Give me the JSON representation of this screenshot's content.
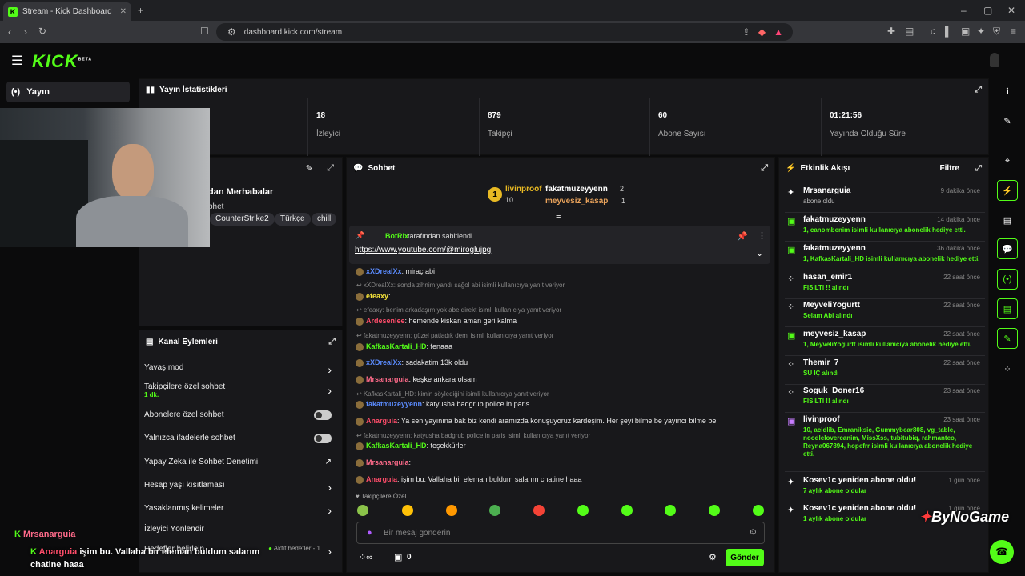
{
  "browser": {
    "tab_title": "Stream - Kick Dashboard",
    "url": "dashboard.kick.com/stream"
  },
  "brand": {
    "logo": "KICK",
    "beta": "BETA",
    "accent": "#53fc18"
  },
  "sidebar": {
    "yayin_label": "Yayın"
  },
  "stats": {
    "title": "Yayın İstatistikleri",
    "items": [
      {
        "value": "18",
        "label": "İzleyici"
      },
      {
        "value": "879",
        "label": "Takipçi"
      },
      {
        "value": "60",
        "label": "Abone Sayısı"
      },
      {
        "value": "01:21:56",
        "label": "Yayında Olduğu Süre"
      }
    ]
  },
  "stream_info": {
    "title_partial": "dan Merhabalar",
    "sub_partial": "bhet",
    "tags": [
      "CounterStrike2",
      "Türkçe",
      "chill"
    ]
  },
  "channel_actions": {
    "title": "Kanal Eylemleri",
    "items": [
      {
        "label": "Yavaş mod",
        "control": "chevron"
      },
      {
        "label": "Takipçilere özel sohbet",
        "sub": "1 dk.",
        "control": "chevron"
      },
      {
        "label": "Abonelere özel sohbet",
        "control": "toggle"
      },
      {
        "label": "Yalnızca ifadelerle sohbet",
        "control": "toggle"
      },
      {
        "label": "Yapay Zeka ile Sohbet Denetimi",
        "control": "external"
      },
      {
        "label": "Hesap yaşı kısıtlaması",
        "control": "chevron"
      },
      {
        "label": "Yasaklanmış kelimeler",
        "control": "chevron"
      },
      {
        "label": "İzleyici Yönlendir",
        "control": "none"
      },
      {
        "label": "Hedefler belirlein",
        "extra": "Aktif hedefler - 1",
        "control": "chevron"
      }
    ]
  },
  "chat": {
    "title": "Sohbet",
    "leaders": {
      "first_name": "livinproof",
      "first_count": "10",
      "second_name": "fakatmuzeyyenn",
      "second_count": "2",
      "third_name": "meyvesiz_kasap",
      "third_count": "1"
    },
    "pinned": {
      "by": "BotRix",
      "by_suffix": "tarafından sabitlendi",
      "link": "https://www.youtube.com/@miroglujpg"
    },
    "messages": [
      {
        "reply": "",
        "user": "xXDrealXx",
        "color": "#5b8cff",
        "text": "miraç abi"
      },
      {
        "reply": "xXDrealXx: sonda zihnim yandı sağol abi isimli kullanıcıya yanıt veriyor",
        "user": "efeaxy",
        "color": "#f5e33b",
        "text": ""
      },
      {
        "reply": "efeaxy: benim arkadaşım yok abe direkt isimli kullanıcıya yanıt veriyor",
        "user": "Ardesenlee",
        "color": "#ff4d6a",
        "text": "hemende kiskan aman geri kalma"
      },
      {
        "reply": "fakatmuzeyyenn: güzel patladık demi isimli kullanıcıya yanıt veriyor",
        "user": "KafkasKartali_HD",
        "color": "#53fc18",
        "text": "fenaaa"
      },
      {
        "reply": "",
        "user": "xXDrealXx",
        "color": "#5b8cff",
        "text": "sadakatim 13k oldu"
      },
      {
        "reply": "",
        "user": "Mrsanarguia",
        "color": "#ff6b8a",
        "text": "keşke ankara olsam"
      },
      {
        "reply": "KafkasKartali_HD: kimin söylediğini isimli kullanıcıya yanıt veriyor",
        "user": "fakatmuzeyyenn",
        "color": "#5b8cff",
        "text": "katyusha badgrub police in paris"
      },
      {
        "reply": "",
        "user": "Anarguia",
        "color": "#ff4d6a",
        "text": "Ya sen yayınına bak biz kendi aramızda konuşuyoruz kardeşim. Her şeyi bilme be yayıncı bilme be"
      },
      {
        "reply": "fakatmuzeyyenn: katyusha badgrub police in paris isimli kullanıcıya yanıt veriyor",
        "user": "KafkasKartali_HD",
        "color": "#53fc18",
        "text": "teşekkürler"
      },
      {
        "reply": "",
        "user": "Mrsanarguia",
        "color": "#ff6b8a",
        "text": ""
      },
      {
        "reply": "",
        "user": "Anarguia",
        "color": "#ff4d6a",
        "text": "işim bu. Vallaha bir eleman buldum salarım chatine haaa"
      }
    ],
    "followers_only": "Takipçilere Özel",
    "input_placeholder": "Bir mesaj gönderin",
    "send_label": "Gönder",
    "bottom_count": "0"
  },
  "activity": {
    "title": "Etkinlik Akışı",
    "filter": "Filtre",
    "events": [
      {
        "name": "Mrsanarguia",
        "time": "9 dakika önce",
        "sub": "abone oldu",
        "icon": "star-icon"
      },
      {
        "name": "fakatmuzeyyenn",
        "time": "14 dakika önce",
        "sub": "1, canombenim isimli kullanıcıya abonelik hediye etti.",
        "icon": "gift-icon"
      },
      {
        "name": "fakatmuzeyyenn",
        "time": "36 dakika önce",
        "sub": "1, KafkasKartali_HD isimli kullanıcıya abonelik hediye etti.",
        "icon": "gift-icon"
      },
      {
        "name": "hasan_emir1",
        "time": "22 saat önce",
        "sub": "FISILTI !! alındı",
        "icon": "kicks-icon"
      },
      {
        "name": "MeyveliYogurtt",
        "time": "22 saat önce",
        "sub": "Selam Abi alındı",
        "icon": "kicks-icon"
      },
      {
        "name": "meyvesiz_kasap",
        "time": "22 saat önce",
        "sub": "1, MeyveliYogurtt isimli kullanıcıya abonelik hediye etti.",
        "icon": "gift-icon"
      },
      {
        "name": "Themir_7",
        "time": "22 saat önce",
        "sub": "SU İÇ alındı",
        "icon": "kicks-icon"
      },
      {
        "name": "Soguk_Doner16",
        "time": "23 saat önce",
        "sub": "FISILTI !! alındı",
        "icon": "kicks-icon"
      },
      {
        "name": "livinproof",
        "time": "23 saat önce",
        "sub": "10, acidlib, Emraniksic, Gummybear808, vg_table, noodlelovercanim, MissXss, tubitubiq, rahmanteo, Reyna067894, hopefrr isimli kullanıcıya abonelik hediye etti.",
        "icon": "gift-icon"
      },
      {
        "name": "Kosev1c yeniden abone oldu!",
        "time": "1 gün önce",
        "sub": "7 aylık abone oldular",
        "icon": "star-icon"
      },
      {
        "name": "Kosev1c yeniden abone oldu!",
        "time": "1 gün önce",
        "sub": "1 aylık abone oldular",
        "icon": "star-icon"
      }
    ]
  },
  "overlay": {
    "watermark": "ByNoGame",
    "line1_user": "Mrsanarguia",
    "line2_user": "Anarguia",
    "line2_text": "işim bu. Vallaha bir eleman buldum salarım chatine haaa"
  }
}
